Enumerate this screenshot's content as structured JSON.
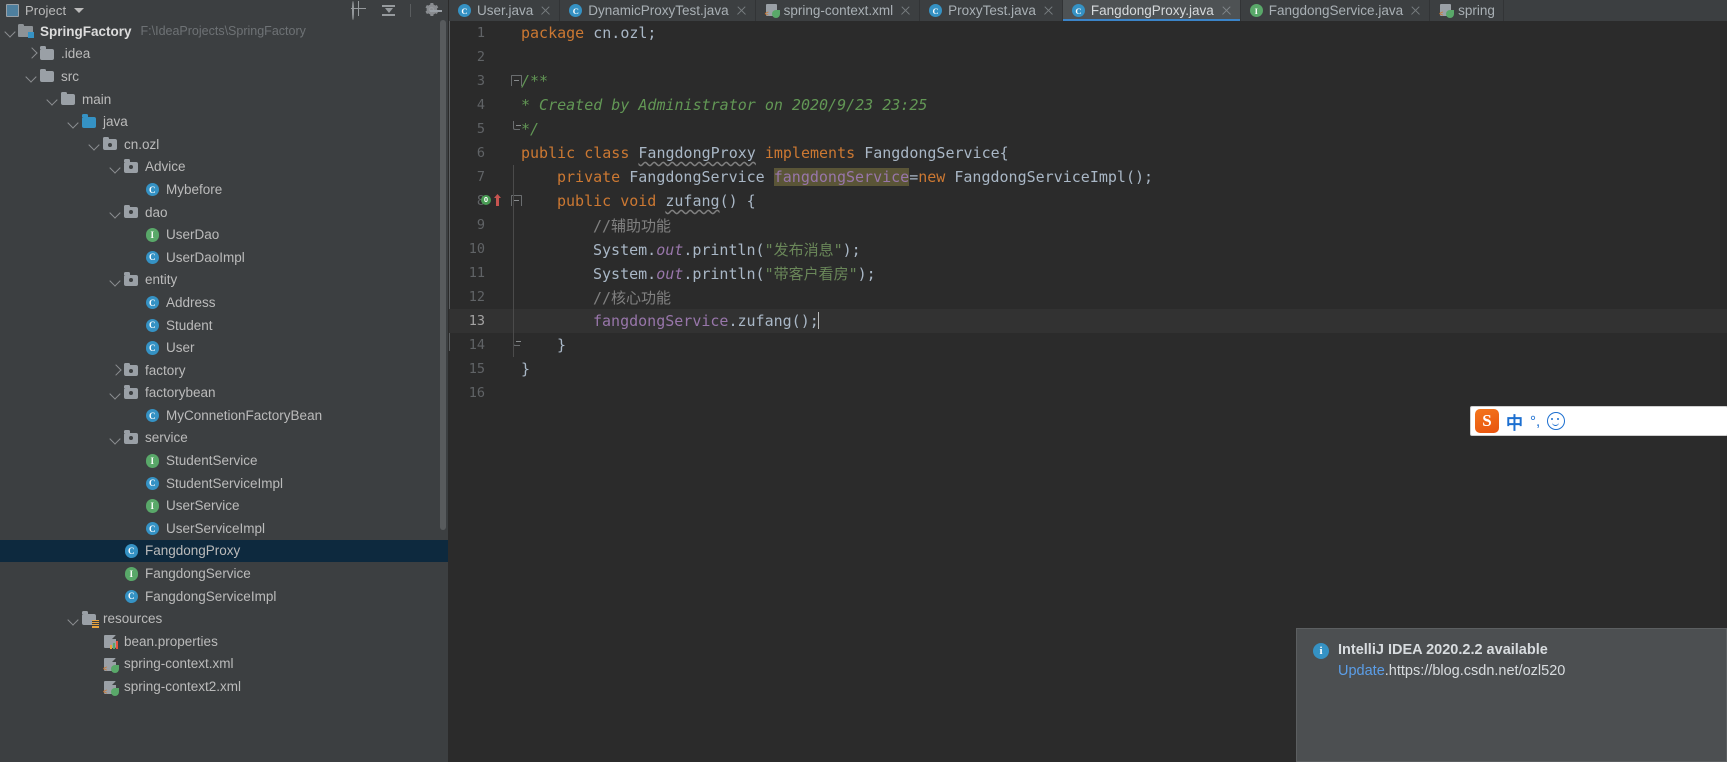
{
  "panel": {
    "title": "Project",
    "icons": [
      "locate-icon",
      "collapse-all-icon",
      "settings-gear-icon"
    ]
  },
  "tree": [
    {
      "indent": 0,
      "twist": "down",
      "icon": "project-folder-icon",
      "label": "SpringFactory",
      "bold": true,
      "path": "F:\\IdeaProjects\\SpringFactory"
    },
    {
      "indent": 1,
      "twist": "right",
      "icon": "folder-icon",
      "label": ".idea"
    },
    {
      "indent": 1,
      "twist": "down",
      "icon": "folder-icon",
      "label": "src"
    },
    {
      "indent": 2,
      "twist": "down",
      "icon": "folder-icon",
      "label": "main"
    },
    {
      "indent": 3,
      "twist": "down",
      "icon": "source-folder-icon",
      "label": "java"
    },
    {
      "indent": 4,
      "twist": "down",
      "icon": "package-icon",
      "label": "cn.ozl"
    },
    {
      "indent": 5,
      "twist": "down",
      "icon": "package-icon",
      "label": "Advice"
    },
    {
      "indent": 6,
      "twist": "none",
      "icon": "class-icon",
      "label": "Mybefore"
    },
    {
      "indent": 5,
      "twist": "down",
      "icon": "package-icon",
      "label": "dao"
    },
    {
      "indent": 6,
      "twist": "none",
      "icon": "interface-icon",
      "label": "UserDao"
    },
    {
      "indent": 6,
      "twist": "none",
      "icon": "class-icon",
      "label": "UserDaoImpl"
    },
    {
      "indent": 5,
      "twist": "down",
      "icon": "package-icon",
      "label": "entity"
    },
    {
      "indent": 6,
      "twist": "none",
      "icon": "class-icon",
      "label": "Address"
    },
    {
      "indent": 6,
      "twist": "none",
      "icon": "class-icon",
      "label": "Student"
    },
    {
      "indent": 6,
      "twist": "none",
      "icon": "class-icon",
      "label": "User"
    },
    {
      "indent": 5,
      "twist": "right",
      "icon": "package-icon",
      "label": "factory"
    },
    {
      "indent": 5,
      "twist": "down",
      "icon": "package-icon",
      "label": "factorybean"
    },
    {
      "indent": 6,
      "twist": "none",
      "icon": "class-icon",
      "label": "MyConnetionFactoryBean"
    },
    {
      "indent": 5,
      "twist": "down",
      "icon": "package-icon",
      "label": "service"
    },
    {
      "indent": 6,
      "twist": "none",
      "icon": "interface-icon",
      "label": "StudentService"
    },
    {
      "indent": 6,
      "twist": "none",
      "icon": "class-icon",
      "label": "StudentServiceImpl"
    },
    {
      "indent": 6,
      "twist": "none",
      "icon": "interface-icon",
      "label": "UserService"
    },
    {
      "indent": 6,
      "twist": "none",
      "icon": "class-icon",
      "label": "UserServiceImpl"
    },
    {
      "indent": 5,
      "twist": "none",
      "icon": "class-icon",
      "label": "FangdongProxy",
      "selected": true
    },
    {
      "indent": 5,
      "twist": "none",
      "icon": "interface-icon",
      "label": "FangdongService"
    },
    {
      "indent": 5,
      "twist": "none",
      "icon": "class-icon",
      "label": "FangdongServiceImpl"
    },
    {
      "indent": 3,
      "twist": "down",
      "icon": "resources-folder-icon",
      "label": "resources"
    },
    {
      "indent": 4,
      "twist": "none",
      "icon": "properties-file-icon",
      "label": "bean.properties"
    },
    {
      "indent": 4,
      "twist": "none",
      "icon": "spring-xml-icon",
      "label": "spring-context.xml"
    },
    {
      "indent": 4,
      "twist": "none",
      "icon": "spring-xml-icon",
      "label": "spring-context2.xml"
    }
  ],
  "tabs": [
    {
      "label": "User.java",
      "icon": "class-icon",
      "active": false
    },
    {
      "label": "DynamicProxyTest.java",
      "icon": "class-icon",
      "active": false
    },
    {
      "label": "spring-context.xml",
      "icon": "spring-xml-icon",
      "active": false
    },
    {
      "label": "ProxyTest.java",
      "icon": "class-icon",
      "active": false
    },
    {
      "label": "FangdongProxy.java",
      "icon": "class-icon",
      "active": true
    },
    {
      "label": "FangdongService.java",
      "icon": "interface-icon",
      "active": false
    },
    {
      "label": "spring",
      "icon": "spring-xml-icon",
      "active": false
    }
  ],
  "editor": {
    "language": "java",
    "active_line": 13,
    "lines": [
      {
        "n": 1,
        "text": "package cn.ozl;"
      },
      {
        "n": 2,
        "text": ""
      },
      {
        "n": 3,
        "text": "/**"
      },
      {
        "n": 4,
        "text": " * Created by Administrator on 2020/9/23 23:25"
      },
      {
        "n": 5,
        "text": " */"
      },
      {
        "n": 6,
        "text": "public class FangdongProxy implements FangdongService{"
      },
      {
        "n": 7,
        "text": "    private FangdongService fangdongService=new FangdongServiceImpl();"
      },
      {
        "n": 8,
        "text": "    public void zufang() {"
      },
      {
        "n": 9,
        "text": "        //辅助功能"
      },
      {
        "n": 10,
        "text": "        System.out.println(\"发布消息\");"
      },
      {
        "n": 11,
        "text": "        System.out.println(\"带客户看房\");"
      },
      {
        "n": 12,
        "text": "        //核心功能"
      },
      {
        "n": 13,
        "text": "        fangdongService.zufang();"
      },
      {
        "n": 14,
        "text": "    }"
      },
      {
        "n": 15,
        "text": "}"
      },
      {
        "n": 16,
        "text": ""
      }
    ]
  },
  "ime": {
    "logo": "sogou-logo",
    "mode": "中",
    "degree": "°,",
    "face": "smiley-icon"
  },
  "notification": {
    "icon": "info-icon",
    "title": "IntelliJ IDEA 2020.2.2 available",
    "link_label": "Update",
    "watermark": ".https://blog.csdn.net/ozl520"
  },
  "colors": {
    "accent": "#3592c4",
    "interface": "#59a869",
    "keyword": "#cc7832",
    "string": "#6a8759",
    "doc_comment": "#629755",
    "line_comment": "#808080",
    "field": "#9876aa",
    "default_text": "#a9b7c6",
    "selection": "#0d293e",
    "editor_bg": "#2b2b2b",
    "panel_bg": "#3c3f41"
  }
}
